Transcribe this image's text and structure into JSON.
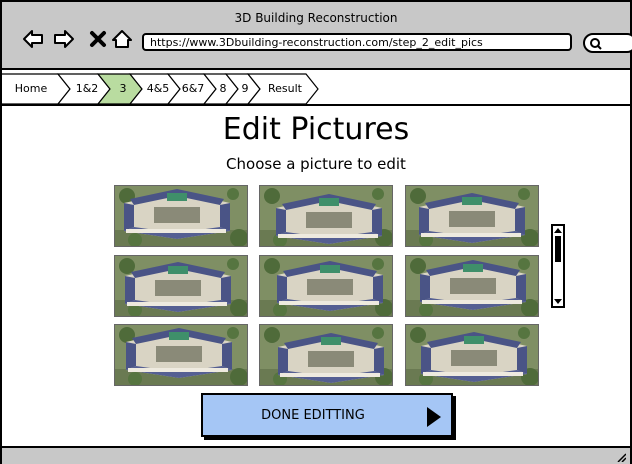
{
  "window": {
    "title": "3D Building Reconstruction"
  },
  "browser": {
    "url": "https://www.3Dbuilding-reconstruction.com/step_2_edit_pics",
    "back_icon": "arrow-left-icon",
    "forward_icon": "arrow-right-icon",
    "stop_icon": "close-icon",
    "home_icon": "home-icon",
    "search_icon": "search-icon"
  },
  "breadcrumb": {
    "items": [
      {
        "label": "Home",
        "active": false
      },
      {
        "label": "1&2",
        "active": false
      },
      {
        "label": "3",
        "active": true
      },
      {
        "label": "4&5",
        "active": false
      },
      {
        "label": "6&7",
        "active": false
      },
      {
        "label": "8",
        "active": false
      },
      {
        "label": "9",
        "active": false
      },
      {
        "label": "Result",
        "active": false
      }
    ],
    "active_color": "#b9dca0"
  },
  "main": {
    "title": "Edit Pictures",
    "subtitle": "Choose a picture to edit",
    "pictures_count": 9
  },
  "done_button": {
    "label": "DONE EDITTING",
    "color": "#a5c6f5",
    "icon": "play-arrow-icon"
  }
}
